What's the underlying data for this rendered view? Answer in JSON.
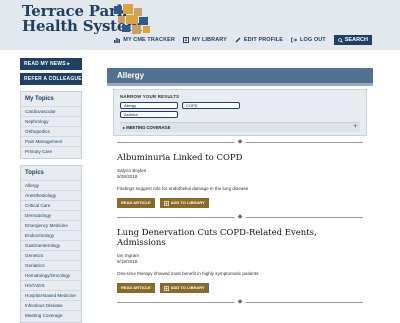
{
  "header": {
    "logo_line1": "Terrace Park",
    "logo_line2": "Health System",
    "nav": [
      {
        "label": "MY CME TRACKER",
        "icon": "chart-icon"
      },
      {
        "label": "MY LIBRARY",
        "icon": "library-icon"
      },
      {
        "label": "EDIT PROFILE",
        "icon": "edit-icon"
      },
      {
        "label": "LOG OUT",
        "icon": "logout-icon"
      }
    ],
    "search_label": "SEARCH"
  },
  "sidebar": {
    "buttons": [
      "READ MY NEWS ▸",
      "REFER A COLLEAGUE ▸"
    ],
    "my_topics_heading": "My Topics",
    "my_topics": [
      "Cardiovascular",
      "Nephrology",
      "Orthopedics",
      "Pain Management",
      "Primary Care"
    ],
    "topics_heading": "Topics",
    "topics": [
      "Allergy",
      "Anesthesiology",
      "Critical Care",
      "Dermatology",
      "Emergency Medicine",
      "Endocrinology",
      "Gastroenterology",
      "Genetics",
      "Geriatrics",
      "Hematology/Oncology",
      "HIV/AIDS",
      "Hospital-Based Medicine",
      "Infectious Disease",
      "Meeting Coverage"
    ]
  },
  "main": {
    "title": "Allergy",
    "filter_label": "NARROW YOUR RESULTS",
    "tags": [
      "Allergy",
      "COPD",
      "Asthma"
    ],
    "meeting_label": "MEETING COVERAGE",
    "meeting_toggle": "+",
    "divider_glyph": "◆",
    "articles": [
      {
        "title": "Albuminuria Linked to COPD",
        "author": "Salynn Boyles",
        "date": "9/28/2018",
        "summary": "Findings suggest role for endothelial damage in the lung disease",
        "read_label": "READ ARTICLE",
        "add_label": "ADD TO LIBRARY"
      },
      {
        "title": "Lung Denervation Cuts COPD-Related Events, Admissions",
        "author": "Ian Ingram",
        "date": "9/19/2018",
        "summary": "One-time therapy showed most benefit in highly symptomatic patients",
        "read_label": "READ ARTICLE",
        "add_label": "ADD TO LIBRARY"
      }
    ]
  },
  "colors": {
    "brand_navy": "#1f3f63",
    "title_bar": "#52708f",
    "button_gold": "#8a6a2a",
    "logo_orange": "#e0a145",
    "logo_tan": "#c9a267",
    "logo_blue": "#2f5b8a"
  }
}
